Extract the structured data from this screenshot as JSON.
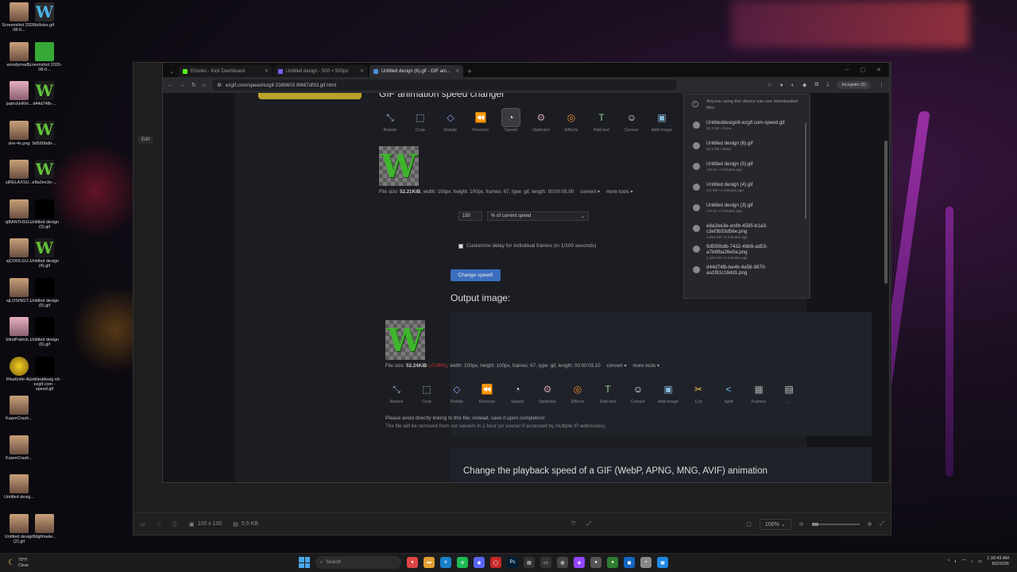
{
  "desktop_icons": [
    {
      "label": "Screenshot 2026-08-0...",
      "kind": "face"
    },
    {
      "label": "fullsize.gif",
      "kind": "w"
    },
    {
      "label": "woodymad...",
      "kind": "face"
    },
    {
      "label": "Screenshot 2026-08-0...",
      "kind": "green"
    },
    {
      "label": "patrickHRH...",
      "kind": "pink"
    },
    {
      "label": "d44d74fb-...",
      "kind": "g"
    },
    {
      "label": "she-4x.png",
      "kind": "face"
    },
    {
      "label": "9d590bdb-...",
      "kind": "g"
    },
    {
      "label": "sjRELAXSU...",
      "kind": "face"
    },
    {
      "label": "e8a2ee3e-...",
      "kind": "g"
    },
    {
      "label": "sjBANTHSG...",
      "kind": "face"
    },
    {
      "label": "Untitled design (3).gif",
      "kind": "blk"
    },
    {
      "label": "sjCOOLGU...",
      "kind": "face"
    },
    {
      "label": "Untitled design (4).gif",
      "kind": "g"
    },
    {
      "label": "sjLOSINGT...",
      "kind": "face"
    },
    {
      "label": "Untitled design (5).gif",
      "kind": "blk"
    },
    {
      "label": "blindPatrick...",
      "kind": "pink"
    },
    {
      "label": "Untitled design (6).gif",
      "kind": "blk"
    },
    {
      "label": "PikaKnife-4...",
      "kind": "yellow"
    },
    {
      "label": "Untitleddesig n6-ezgif.com -speed.gif",
      "kind": "blk"
    },
    {
      "label": "KaareCrash...",
      "kind": "face"
    },
    {
      "label": "KaareCrash...",
      "kind": "face"
    },
    {
      "label": "Untitled desig...",
      "kind": "face"
    },
    {
      "label": "Untitled design (2).gif",
      "kind": "face"
    },
    {
      "label": "3dgifmake...",
      "kind": "face"
    }
  ],
  "tabs": [
    {
      "label": "Emotes - Kick Dashboard",
      "color": "#53fc18"
    },
    {
      "label": "Untitled design - 500 × 500px",
      "color": "#7d5cf0"
    },
    {
      "label": "Untitled design (6).gif - GIF ani...",
      "color": "#4a90d9"
    }
  ],
  "address": "ezgif.com/speed/ezgif-2389603 8f487df33.gif.html",
  "incognito_label": "Incognito (5)",
  "page": {
    "title": "GIF animation speed changer",
    "tools_top": [
      "Resize",
      "Crop",
      "Rotate",
      "Reverse",
      "Speed",
      "Optimize",
      "Effects",
      "Add text",
      "Censor",
      "Add image"
    ],
    "input_info": {
      "prefix": "File size: ",
      "size": "52.21KiB",
      "rest": ", width: 100px, height: 100px, frames: 67, type: gif, length: 00:00:05.00"
    },
    "convert_label": "convert ▾",
    "more_tools_label": "more tools ▾",
    "speed_value": "150",
    "speed_mode": "% of current speed",
    "customize_label": "Customize delay for individual frames (in 1/100 seconds)",
    "change_button": "Change speed!",
    "output_title": "Output image:",
    "output_info": {
      "prefix": "File size: ",
      "size": "52.24KiB",
      "delta": "(-0.06%)",
      "rest": ", width: 100px, height: 100px, frames: 67, type: gif, length: 00:00:03.10"
    },
    "tools_bottom": [
      "Resize",
      "Crop",
      "Rotate",
      "Reverse",
      "Speed",
      "Optimize",
      "Effects",
      "Add text",
      "Censor",
      "Add image",
      "Cut",
      "Split",
      "Frames",
      "..."
    ],
    "note1": "Please avoid directly linking to this file; instead, save it upon completion!",
    "note2": "The file will be removed from our servers in 1 hour (or sooner if accessed by multiple IP addresses).",
    "bottom_heading": "Change the playback speed of a GIF (WebP, APNG, MNG, AVIF) animation",
    "gif_letter": "W"
  },
  "downloads": {
    "header": "Anyone using this device can see downloaded files",
    "items": [
      {
        "name": "Untitleddesign6-ezgif.com-speed.gif",
        "sub": "52.2 KB • Done"
      },
      {
        "name": "Untitled design (6).gif",
        "sub": "52.2 KB • Done"
      },
      {
        "name": "Untitled design (5).gif",
        "sub": "175 B • 2 minutes ago"
      },
      {
        "name": "Untitled design (4).gif",
        "sub": "3.5 KB • 2 minutes ago"
      },
      {
        "name": "Untitled design (3).gif",
        "sub": "175 B • 2 minutes ago"
      },
      {
        "name": "e8a2ee3e-ec8b-4585-b1a3-c3ef3b53d56e.png",
        "sub": "1,554 KB • 5 minutes ago"
      },
      {
        "name": "9d590bdb-7432-46b9-ad53-a7b6fba26e0a.png",
        "sub": "1,329 KB • 6 minutes ago"
      },
      {
        "name": "d44d74fb-be4b-4a56-9870-aa1f81c16dd1.png",
        "sub": ""
      }
    ]
  },
  "viewer": {
    "edit_label": "Edit",
    "dimensions": "100 x 100",
    "size": "5.5 KB",
    "zoom": "100%",
    "zoom_level": 0.14
  },
  "taskbar": {
    "temp": "79°F",
    "condition": "Clear",
    "search_label": "Search",
    "time": "1:30:43 AM",
    "date": "8/2/2026"
  }
}
